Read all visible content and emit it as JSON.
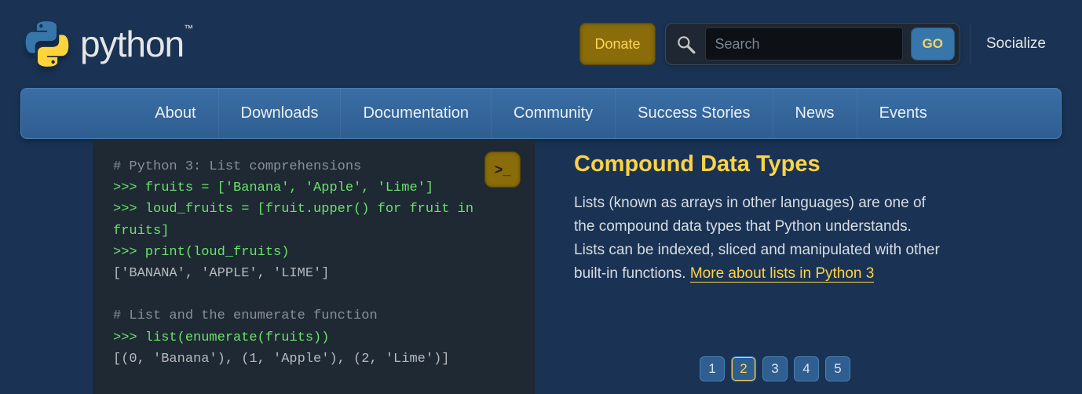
{
  "header": {
    "donate": "Donate",
    "search_placeholder": "Search",
    "go": "GO",
    "socialize": "Socialize"
  },
  "nav": [
    "About",
    "Downloads",
    "Documentation",
    "Community",
    "Success Stories",
    "News",
    "Events"
  ],
  "code": {
    "l1_comment": "# Python 3: List comprehensions",
    "l2_code": ">>> fruits = ['Banana', 'Apple', 'Lime']",
    "l3_code": ">>> loud_fruits = [fruit.upper() for fruit in fruits]",
    "l4_code": ">>> print(loud_fruits)",
    "l5_output": "['BANANA', 'APPLE', 'LIME']",
    "l7_comment": "# List and the enumerate function",
    "l8_code": ">>> list(enumerate(fruits))",
    "l9_output": "[(0, 'Banana'), (1, 'Apple'), (2, 'Lime')]"
  },
  "info": {
    "title": "Compound Data Types",
    "body": "Lists (known as arrays in other languages) are one of the compound data types that Python understands. Lists can be indexed, sliced and manipulated with other built-in functions. ",
    "link": "More about lists in Python 3"
  },
  "pager": [
    "1",
    "2",
    "3",
    "4",
    "5"
  ],
  "pager_active": "2",
  "run_glyph": ">_"
}
